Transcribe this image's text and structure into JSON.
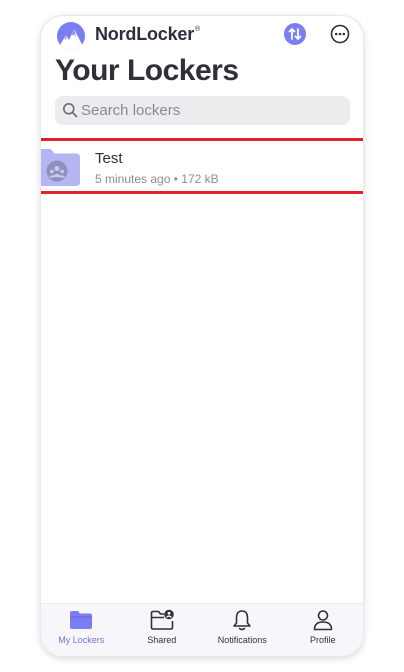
{
  "app": {
    "brand_name": "NordLocker",
    "brand_mark": "®",
    "accent_color": "#7a7ef2",
    "highlight_color": "#e6202a"
  },
  "header": {
    "title": "Your Lockers",
    "sync_icon": "sync-arrows-icon",
    "more_icon": "more-horizontal-icon"
  },
  "search": {
    "placeholder": "Search lockers",
    "value": ""
  },
  "lockers": [
    {
      "name": "Test",
      "modified": "5 minutes ago",
      "separator": "•",
      "size": "172 kB",
      "icon": "shared-folder-icon"
    }
  ],
  "tabbar": {
    "items": [
      {
        "label": "My Lockers",
        "icon": "folder-icon",
        "active": true
      },
      {
        "label": "Shared",
        "icon": "shared-folder-icon",
        "active": false
      },
      {
        "label": "Notifications",
        "icon": "bell-icon",
        "active": false
      },
      {
        "label": "Profile",
        "icon": "person-icon",
        "active": false
      }
    ]
  }
}
